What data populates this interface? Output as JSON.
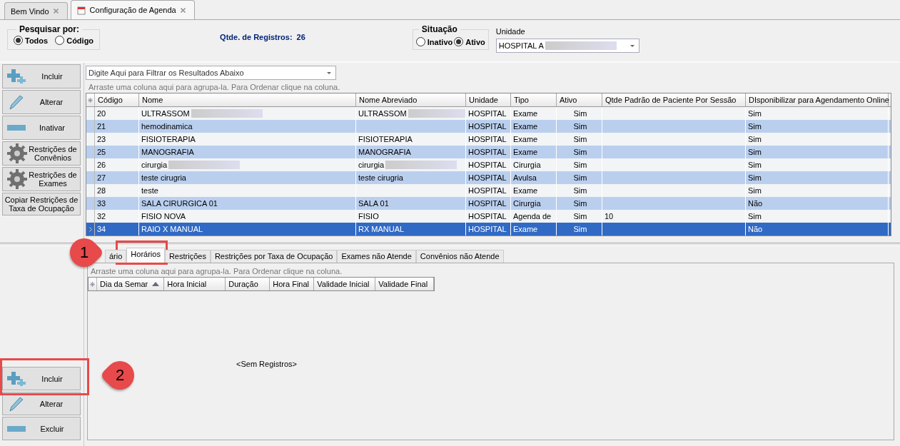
{
  "doc_tabs": [
    {
      "label": "Bem Vindo",
      "selected": false,
      "kind": "plain"
    },
    {
      "label": "Configuração de Agenda",
      "selected": true,
      "kind": "calendar"
    }
  ],
  "search_by": {
    "legend": "Pesquisar por:",
    "options": [
      {
        "label": "Todos",
        "selected": true
      },
      {
        "label": "Código",
        "selected": false
      }
    ]
  },
  "record_count": {
    "label": "Qtde. de Registros:",
    "value": "26"
  },
  "situacao": {
    "legend": "Situação",
    "options": [
      {
        "label": "Inativo",
        "selected": false
      },
      {
        "label": "Ativo",
        "selected": true
      }
    ]
  },
  "unidade": {
    "label": "Unidade",
    "value": "HOSPITAL A"
  },
  "side_buttons": [
    {
      "label": "Incluir",
      "kind": "plus"
    },
    {
      "label": "Alterar",
      "kind": "pencil"
    },
    {
      "label": "Inativar",
      "kind": "minus"
    },
    {
      "label": "Restrições de Convênios",
      "kind": "gear"
    },
    {
      "label": "Restrições de Exames",
      "kind": "gear"
    },
    {
      "label": "Copiar Restrições de Taxa de Ocupação",
      "kind": "text"
    }
  ],
  "filter": {
    "placeholder": "Digite Aqui para Filtrar os Resultados Abaixo"
  },
  "group_hint": "Arraste uma coluna aqui para agrupa-la. Para Ordenar clique na coluna.",
  "table": {
    "columns": [
      "Código",
      "Nome",
      "Nome Abreviado",
      "Unidade",
      "Tipo",
      "Ativo",
      "Qtde Padrão de Paciente Por Sessão",
      "DIsponibilizar para Agendamento Online"
    ],
    "rows": [
      {
        "cells": [
          "20",
          "ULTRASSOM",
          "ULTRASSOM",
          "HOSPITAL",
          "Exame",
          "Sim",
          "",
          "Sim"
        ],
        "blur": [
          true,
          true
        ],
        "selected": false
      },
      {
        "cells": [
          "21",
          "hemodinamica",
          "",
          "HOSPITAL",
          "Exame",
          "Sim",
          "",
          "Sim"
        ],
        "blur": [
          false,
          false
        ],
        "selected": false
      },
      {
        "cells": [
          "23",
          "FISIOTERAPIA",
          "FISIOTERAPIA",
          "HOSPITAL",
          "Exame",
          "Sim",
          "",
          "Sim"
        ],
        "blur": [
          false,
          false
        ],
        "selected": false
      },
      {
        "cells": [
          "25",
          "MANOGRAFIA",
          "MANOGRAFIA",
          "HOSPITAL",
          "Exame",
          "Sim",
          "",
          "Sim"
        ],
        "blur": [
          false,
          false
        ],
        "selected": false
      },
      {
        "cells": [
          "26",
          "cirurgia",
          "cirurgia",
          "HOSPITAL",
          "Cirurgia",
          "Sim",
          "",
          "Sim"
        ],
        "blur": [
          true,
          true
        ],
        "selected": false
      },
      {
        "cells": [
          "27",
          "teste cirugria",
          "teste cirugria",
          "HOSPITAL",
          "Avulsa",
          "Sim",
          "",
          "Sim"
        ],
        "blur": [
          false,
          false
        ],
        "selected": false
      },
      {
        "cells": [
          "28",
          "teste",
          "",
          "HOSPITAL",
          "Exame",
          "Sim",
          "",
          "Sim"
        ],
        "blur": [
          false,
          false
        ],
        "selected": false
      },
      {
        "cells": [
          "33",
          "SALA CIRURGICA 01",
          "SALA 01",
          "HOSPITAL",
          "Cirurgia",
          "Sim",
          "",
          "Não"
        ],
        "blur": [
          false,
          false
        ],
        "selected": false
      },
      {
        "cells": [
          "32",
          "FISIO NOVA",
          "FISIO",
          "HOSPITAL",
          "Agenda de",
          "Sim",
          "10",
          "Sim"
        ],
        "blur": [
          false,
          false
        ],
        "selected": false
      },
      {
        "cells": [
          "34",
          "RAIO X MANUAL",
          "RX MANUAL",
          "HOSPITAL",
          "Exame",
          "Sim",
          "",
          "Não"
        ],
        "blur": [
          false,
          false
        ],
        "selected": true
      }
    ]
  },
  "detail_tabs": [
    {
      "label": "ário",
      "selected": false
    },
    {
      "label": "Horários",
      "selected": true
    },
    {
      "label": "Restrições",
      "selected": false
    },
    {
      "label": "Restrições por Taxa de Ocupação",
      "selected": false
    },
    {
      "label": "Exames não Atende",
      "selected": false
    },
    {
      "label": "Convênios não Atende",
      "selected": false
    }
  ],
  "detail_group_hint": "Arraste uma coluna aqui para agrupa-la. Para Ordenar clique na coluna.",
  "detail_table": {
    "columns": [
      {
        "label": "Dia da Semar",
        "sorted": true
      },
      {
        "label": "Hora Inicial",
        "sorted": false
      },
      {
        "label": "Duração",
        "sorted": false
      },
      {
        "label": "Hora Final",
        "sorted": false
      },
      {
        "label": "Validade Inicial",
        "sorted": false
      },
      {
        "label": "Validade Final",
        "sorted": false
      }
    ],
    "empty": "<Sem Registros>"
  },
  "detail_buttons": [
    {
      "label": "Incluir",
      "kind": "plus"
    },
    {
      "label": "Alterar",
      "kind": "pencil"
    },
    {
      "label": "Excluir",
      "kind": "minus"
    }
  ],
  "callouts": [
    {
      "number": "1"
    },
    {
      "number": "2"
    }
  ]
}
